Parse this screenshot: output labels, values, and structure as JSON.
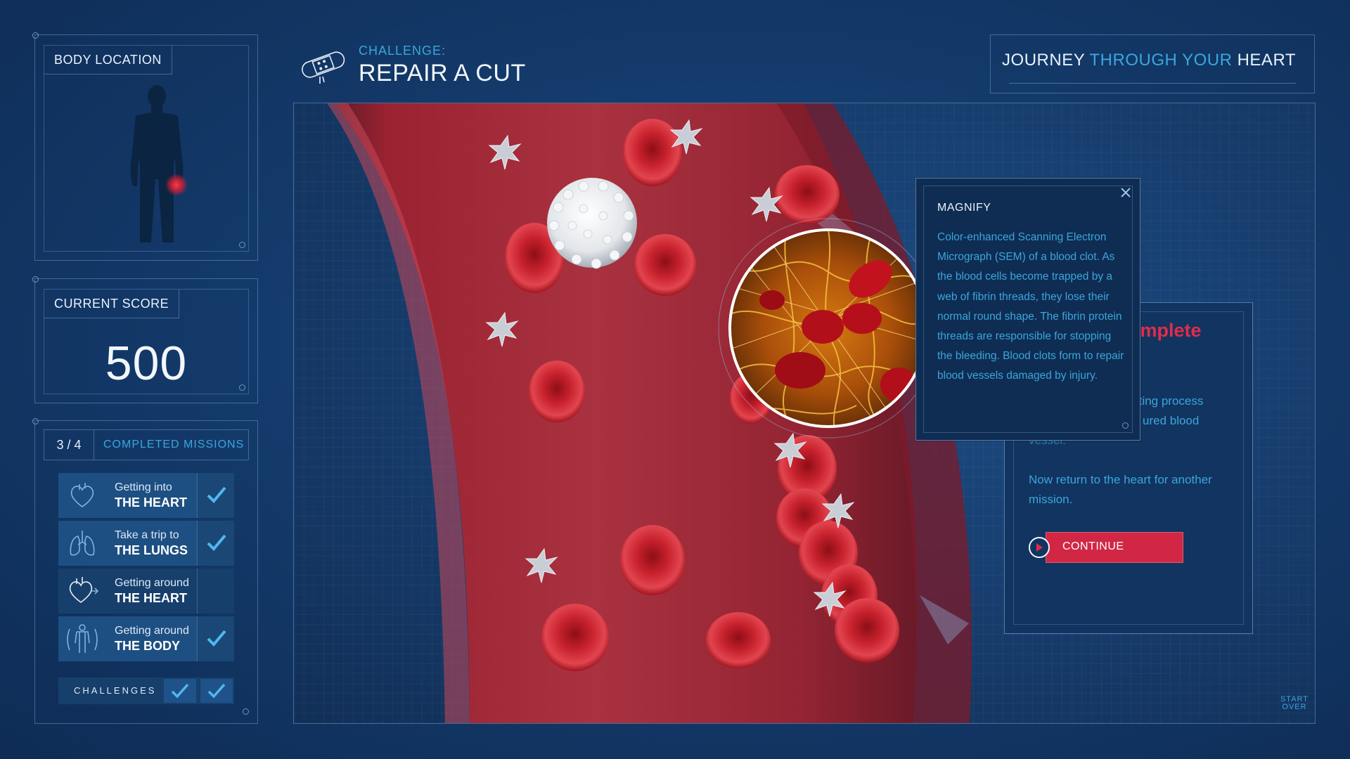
{
  "body_location": {
    "label": "BODY LOCATION"
  },
  "score": {
    "label": "CURRENT SCORE",
    "value": "500"
  },
  "missions": {
    "count": "3 / 4",
    "title": "COMPLETED MISSIONS",
    "items": [
      {
        "line1": "Getting into",
        "line2": "THE HEART",
        "icon": "heart-icon",
        "completed": true
      },
      {
        "line1": "Take a trip to",
        "line2": "THE LUNGS",
        "icon": "lungs-icon",
        "completed": true
      },
      {
        "line1": "Getting around",
        "line2": "THE HEART",
        "icon": "heart-flow-icon",
        "completed": false
      },
      {
        "line1": "Getting around",
        "line2": "THE BODY",
        "icon": "body-icon",
        "completed": true
      }
    ],
    "challenges_label": "CHALLENGES",
    "challenges_completed": 2
  },
  "header": {
    "kicker": "CHALLENGE:",
    "title": "REPAIR A CUT",
    "icon": "bandage-icon"
  },
  "journey": {
    "part1": "JOURNEY",
    "part2": "THROUGH YOUR",
    "part3": "HEART"
  },
  "magnify": {
    "title": "MAGNIFY",
    "text": "Color-enhanced Scanning Electron Micrograph (SEM) of a blood clot. As the blood cells become trapped by a web of fibrin threads, they lose their normal round shape. The fibrin protein threads are responsible for stopping the bleeding. Blood clots form to repair blood vessels damaged by injury."
  },
  "complete_dialog": {
    "title_visible": "omplete",
    "line_partial_1": "tting process",
    "line_partial_2": "ured blood",
    "line_partial_3": "vessel.",
    "text": "Now return to the heart for another mission.",
    "continue_label": "CONTINUE"
  },
  "start_over": {
    "line1": "START",
    "line2": "OVER"
  },
  "colors": {
    "accent_blue": "#3aa6dc",
    "accent_red": "#d22645",
    "background": "#143b6c",
    "blood_red": "#b82a35"
  }
}
